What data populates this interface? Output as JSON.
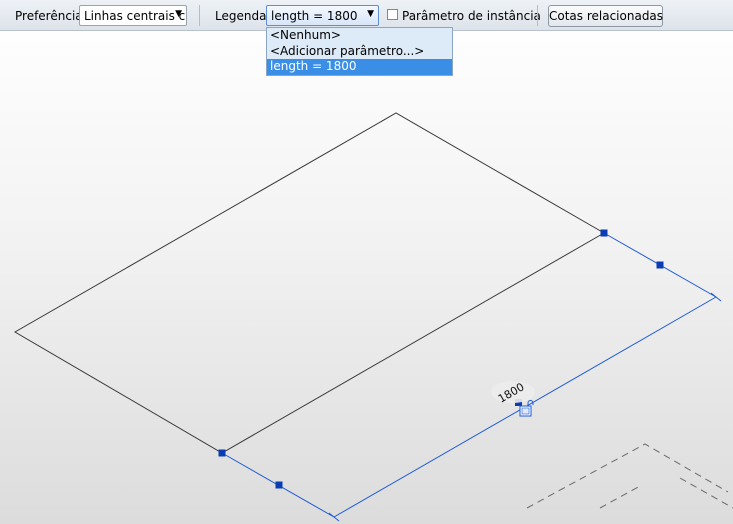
{
  "options_bar": {
    "preference_label": "Preferência:",
    "preference_value": "Linhas centrais c",
    "legend_label": "Legenda:",
    "legend_value": "length = 1800",
    "instance_param_label": "Parâmetro de instância",
    "instance_param_checked": false,
    "related_dims_button": "Cotas relacionadas"
  },
  "legend_dropdown": {
    "items": [
      "<Nenhum>",
      "<Adicionar parâmetro...>",
      "length = 1800"
    ],
    "selected_index": 2
  },
  "canvas": {
    "dimension_text": "1800",
    "colors": {
      "geometry": "#3a3a3a",
      "dimension": "#1e5ad6",
      "grip": "#0a3cb4",
      "selection": "#3a8ee6"
    }
  }
}
